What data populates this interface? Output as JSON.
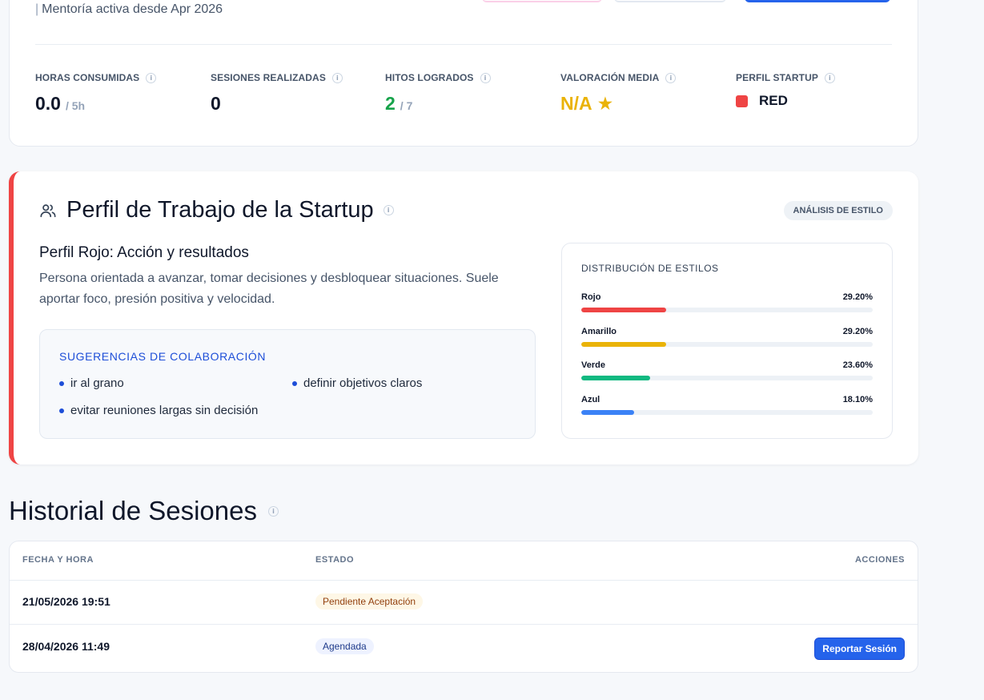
{
  "mentorship": {
    "active_since": "Mentoría activa desde Apr 2026"
  },
  "stats": [
    {
      "label": "HORAS CONSUMIDAS",
      "value": "0.0",
      "sub": "/ 5h"
    },
    {
      "label": "SESIONES REALIZADAS",
      "value": "0",
      "sub": ""
    },
    {
      "label": "HITOS LOGRADOS",
      "value": "2",
      "sub": "/ 7"
    },
    {
      "label": "VALORACIÓN MEDIA",
      "value": "N/A",
      "icon": "star-icon"
    },
    {
      "label": "PERFIL STARTUP",
      "value": "RED",
      "color": "#ef4444"
    }
  ],
  "profile": {
    "title": "Perfil de Trabajo de la Startup",
    "badge": "ANÁLISIS DE ESTILO",
    "subtitle": "Perfil Rojo: Acción y resultados",
    "description": "Persona orientada a avanzar, tomar decisiones y desbloquear situaciones. Suele aportar foco, presión positiva y velocidad.",
    "accent_color": "#ef4444",
    "collab_title": "SUGERENCIAS DE COLABORACIÓN",
    "collab_items": [
      "ir al grano",
      "definir objetivos claros",
      "evitar reuniones largas sin decisión"
    ]
  },
  "distribution": {
    "title": "DISTRIBUCIÓN DE ESTILOS",
    "items": [
      {
        "name": "Rojo",
        "value": "29.20%",
        "percent": 29.2,
        "color": "#ef4444"
      },
      {
        "name": "Amarillo",
        "value": "29.20%",
        "percent": 29.2,
        "color": "#eab308"
      },
      {
        "name": "Verde",
        "value": "23.60%",
        "percent": 23.6,
        "color": "#10b981"
      },
      {
        "name": "Azul",
        "value": "18.10%",
        "percent": 18.1,
        "color": "#3b82f6"
      }
    ]
  },
  "sessions": {
    "title": "Historial de Sesiones",
    "columns": [
      "FECHA Y HORA",
      "ESTADO",
      "ACCIONES"
    ],
    "rows": [
      {
        "date": "21/05/2026 19:51",
        "status": "Pendiente Aceptación",
        "action": ""
      },
      {
        "date": "28/04/2026 11:49",
        "status": "Agendada",
        "action": "Reportar Sesión"
      }
    ]
  }
}
